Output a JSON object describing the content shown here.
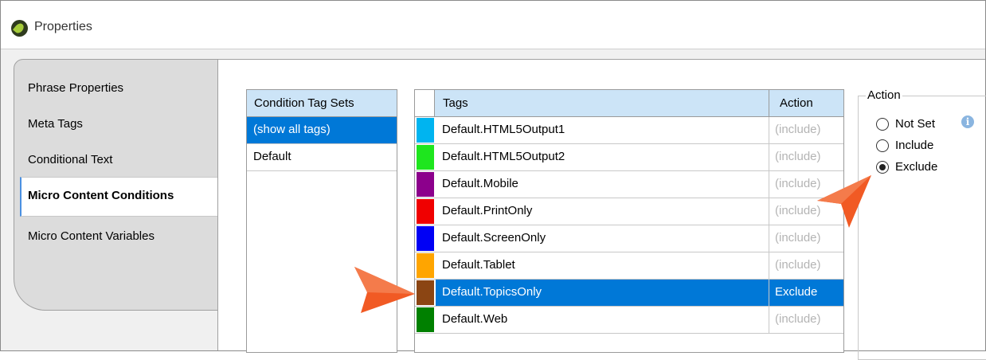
{
  "window": {
    "title": "Properties"
  },
  "sidebar": {
    "items": [
      {
        "label": "Phrase Properties"
      },
      {
        "label": "Meta Tags"
      },
      {
        "label": "Conditional Text"
      },
      {
        "label": "Micro Content Conditions"
      },
      {
        "label": "Micro Content Variables"
      }
    ],
    "active_index": 3
  },
  "condition_tag_sets": {
    "header": "Condition Tag Sets",
    "rows": [
      "(show all tags)",
      "Default"
    ],
    "selected_index": 0
  },
  "tags_table": {
    "headers": {
      "tags": "Tags",
      "action": "Action"
    },
    "rows": [
      {
        "name": "Default.HTML5Output1",
        "action": "(include)",
        "color": "#00b4f0"
      },
      {
        "name": "Default.HTML5Output2",
        "action": "(include)",
        "color": "#1ee61e"
      },
      {
        "name": "Default.Mobile",
        "action": "(include)",
        "color": "#8c008c"
      },
      {
        "name": "Default.PrintOnly",
        "action": "(include)",
        "color": "#f00000"
      },
      {
        "name": "Default.ScreenOnly",
        "action": "(include)",
        "color": "#0000f5"
      },
      {
        "name": "Default.Tablet",
        "action": "(include)",
        "color": "#ffa500"
      },
      {
        "name": "Default.TopicsOnly",
        "action": "Exclude",
        "color": "#8b4513"
      },
      {
        "name": "Default.Web",
        "action": "(include)",
        "color": "#008000"
      }
    ],
    "selected_index": 6
  },
  "action_group": {
    "legend": "Action",
    "options": [
      "Not Set",
      "Include",
      "Exclude"
    ],
    "selected": "Exclude"
  },
  "icons": {
    "app": "flare-app-icon",
    "info": "info-icon",
    "callouts": "callout-arrow-icon"
  },
  "colors": {
    "selection": "#0078d7",
    "header": "#cce4f7",
    "callout": "#f15a24"
  }
}
